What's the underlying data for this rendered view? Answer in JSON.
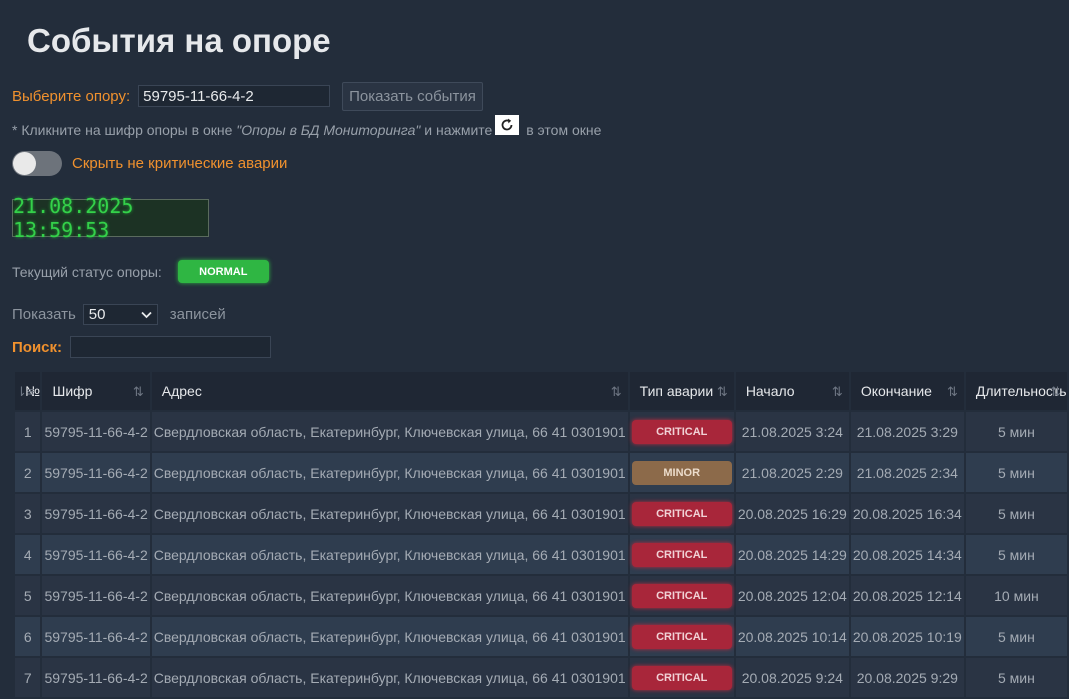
{
  "title": "События на опоре",
  "select_support": {
    "label": "Выберите опору:",
    "value": "59795-11-66-4-2",
    "button": "Показать события"
  },
  "hint": {
    "prefix": "* Кликните на шифр опоры в окне ",
    "italic": "\"Опоры в БД Мониторинга\"",
    "middle": " и нажмите",
    "suffix": " в этом окне"
  },
  "toggle": {
    "label": "Скрыть не критические аварии",
    "on": false
  },
  "clock": "21.08.2025 13:59:53",
  "status": {
    "label": "Текущий статус опоры:",
    "value": "NORMAL",
    "color": "#2fb643"
  },
  "paging": {
    "show": "Показать",
    "page_size": "50",
    "records": "записей"
  },
  "search": {
    "label": "Поиск:",
    "value": ""
  },
  "table": {
    "columns": [
      "№",
      "Шифр",
      "Адрес",
      "Тип аварии",
      "Начало",
      "Окончание",
      "Длительность"
    ],
    "rows": [
      {
        "n": "1",
        "code": "59795-11-66-4-2",
        "address": "Свердловская область, Екатеринбург, Ключевская улица, 66 41 0301901",
        "type": "CRITICAL",
        "start": "21.08.2025 3:24",
        "end": "21.08.2025 3:29",
        "duration": "5 мин"
      },
      {
        "n": "2",
        "code": "59795-11-66-4-2",
        "address": "Свердловская область, Екатеринбург, Ключевская улица, 66 41 0301901",
        "type": "MINOR",
        "start": "21.08.2025 2:29",
        "end": "21.08.2025 2:34",
        "duration": "5 мин"
      },
      {
        "n": "3",
        "code": "59795-11-66-4-2",
        "address": "Свердловская область, Екатеринбург, Ключевская улица, 66 41 0301901",
        "type": "CRITICAL",
        "start": "20.08.2025 16:29",
        "end": "20.08.2025 16:34",
        "duration": "5 мин"
      },
      {
        "n": "4",
        "code": "59795-11-66-4-2",
        "address": "Свердловская область, Екатеринбург, Ключевская улица, 66 41 0301901",
        "type": "CRITICAL",
        "start": "20.08.2025 14:29",
        "end": "20.08.2025 14:34",
        "duration": "5 мин"
      },
      {
        "n": "5",
        "code": "59795-11-66-4-2",
        "address": "Свердловская область, Екатеринбург, Ключевская улица, 66 41 0301901",
        "type": "CRITICAL",
        "start": "20.08.2025 12:04",
        "end": "20.08.2025 12:14",
        "duration": "10 мин"
      },
      {
        "n": "6",
        "code": "59795-11-66-4-2",
        "address": "Свердловская область, Екатеринбург, Ключевская улица, 66 41 0301901",
        "type": "CRITICAL",
        "start": "20.08.2025 10:14",
        "end": "20.08.2025 10:19",
        "duration": "5 мин"
      },
      {
        "n": "7",
        "code": "59795-11-66-4-2",
        "address": "Свердловская область, Екатеринбург, Ключевская улица, 66 41 0301901",
        "type": "CRITICAL",
        "start": "20.08.2025 9:24",
        "end": "20.08.2025 9:29",
        "duration": "5 мин"
      }
    ]
  },
  "colors": {
    "critical": "#a8263a",
    "minor": "#8c6a4a",
    "accent": "#f0912e",
    "clock": "#34d14a"
  }
}
